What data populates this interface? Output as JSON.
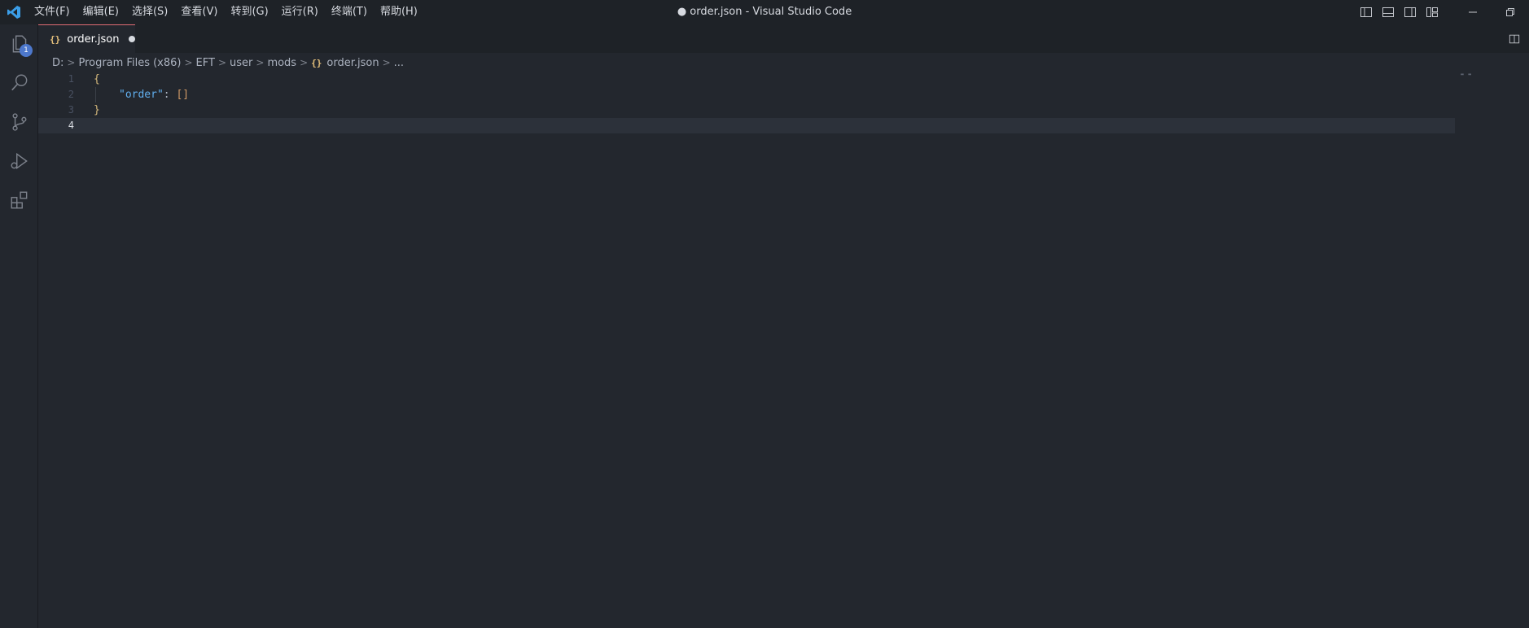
{
  "window": {
    "title": "● order.json - Visual Studio Code"
  },
  "menu": [
    "文件(F)",
    "编辑(E)",
    "选择(S)",
    "查看(V)",
    "转到(G)",
    "运行(R)",
    "终端(T)",
    "帮助(H)"
  ],
  "activity_bar": {
    "explorer_badge": "1"
  },
  "tab": {
    "icon": "{}",
    "label": "order.json"
  },
  "breadcrumb": {
    "items": [
      "D:",
      "Program Files (x86)",
      "EFT",
      "user",
      "mods"
    ],
    "file_icon": "{}",
    "file": "order.json",
    "more": "..."
  },
  "editor": {
    "line_numbers": [
      "1",
      "2",
      "3",
      "4"
    ],
    "line1": "{",
    "line2_key": "\"order\"",
    "line2_colon": ": ",
    "line2_value": "[]",
    "line3": "}"
  },
  "colors": {
    "accent_tab_border": "#e06c75",
    "badge": "#4d78cc",
    "json_key": "#61afef",
    "json_bracket": "#d19a66",
    "brace": "#c678dd"
  }
}
